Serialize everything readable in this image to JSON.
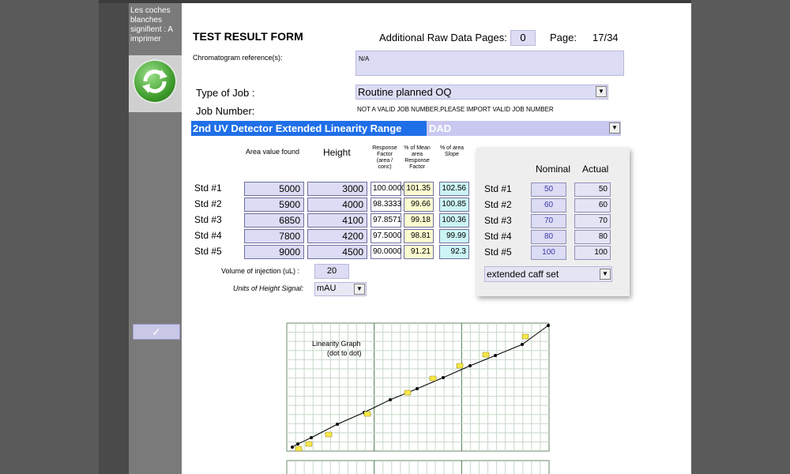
{
  "sidebar": {
    "note": "Les coches blanches signifient : A imprimer",
    "check": "✓"
  },
  "form": {
    "title": "TEST RESULT FORM",
    "additional_pages_label": "Additional Raw Data Pages:",
    "additional_pages_value": "0",
    "page_label": "Page:",
    "page_value": "17/34",
    "chromatogram_label": "Chromatogram reference(s):",
    "chromatogram_value": "N/A",
    "type_of_job_label": "Type of Job :",
    "type_of_job_value": "Routine planned OQ",
    "job_number_label": "Job Number:",
    "job_number_value": "NOT A VALID JOB NUMBER,PLEASE IMPORT VALID JOB NUMBER",
    "detector_title": "2nd UV Detector  Extended Linearity Range",
    "detector_value": "DAD"
  },
  "table": {
    "headers": {
      "area": "Area value found",
      "height": "Height",
      "response": "Response Factor (area / conc)",
      "mean": "% of Mean area Response Factor",
      "slope": "% of area Slope"
    },
    "rows": [
      {
        "label": "Std #1",
        "area": "5000",
        "height": "3000",
        "response": "100.0000",
        "mean": "101.35",
        "slope": "102.56"
      },
      {
        "label": "Std #2",
        "area": "5900",
        "height": "4000",
        "response": "98.3333",
        "mean": "99.66",
        "slope": "100.85"
      },
      {
        "label": "Std #3",
        "area": "6850",
        "height": "4100",
        "response": "97.8571",
        "mean": "99.18",
        "slope": "100.36"
      },
      {
        "label": "Std #4",
        "area": "7800",
        "height": "4200",
        "response": "97.5000",
        "mean": "98.81",
        "slope": "99.99"
      },
      {
        "label": "Std #5",
        "area": "9000",
        "height": "4500",
        "response": "90.0000",
        "mean": "91.21",
        "slope": "92.3"
      }
    ],
    "volume_label": "Volume of injection  (uL) :",
    "volume_value": "20",
    "units_label": "Units of Height Signal:",
    "units_value": "mAU"
  },
  "panel": {
    "nominal_header": "Nominal",
    "actual_header": "Actual",
    "rows": [
      {
        "label": "Std #1",
        "nominal": "50",
        "actual": "50"
      },
      {
        "label": "Std #2",
        "nominal": "60",
        "actual": "60"
      },
      {
        "label": "Std #3",
        "nominal": "70",
        "actual": "70"
      },
      {
        "label": "Std #4",
        "nominal": "80",
        "actual": "80"
      },
      {
        "label": "Std #5",
        "nominal": "100",
        "actual": "100"
      }
    ],
    "set_value": "extended caff set"
  },
  "graph": {
    "label_line1": "Linearity Graph",
    "label_line2": "(dot to dot)"
  }
}
